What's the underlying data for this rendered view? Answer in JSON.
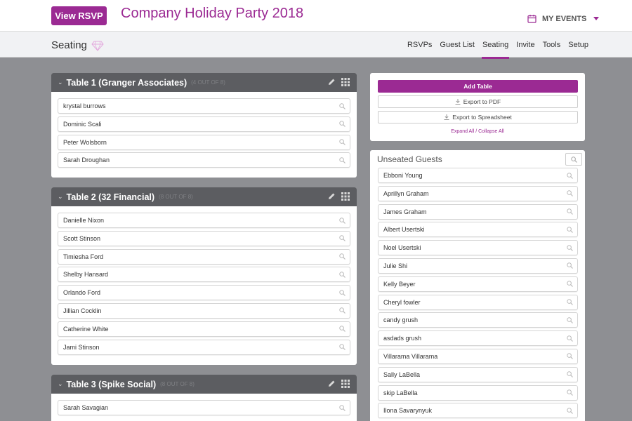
{
  "header": {
    "view_rsvp_label": "View RSVP",
    "event_title": "Company Holiday Party 2018",
    "my_events_label": "MY EVENTS"
  },
  "subnav": {
    "section_title": "Seating",
    "tabs": [
      "RSVPs",
      "Guest List",
      "Seating",
      "Invite",
      "Tools",
      "Setup"
    ],
    "active_tab": "Seating"
  },
  "tables": [
    {
      "name": "Table 1 (Granger Associates)",
      "count": "(4 OUT OF 8)",
      "guests": [
        "krystal burrows",
        "Dominic Scali",
        "Peter Wolsborn",
        "Sarah Droughan"
      ]
    },
    {
      "name": "Table 2 (32 Financial)",
      "count": "(8 OUT OF 8)",
      "guests": [
        "Danielle Nixon",
        "Scott Stinson",
        "Timiesha Ford",
        "Shelby Hansard",
        "Orlando Ford",
        "Jillian Cocklin",
        "Catherine White",
        "Jami Stinson"
      ]
    },
    {
      "name": "Table 3 (Spike Social)",
      "count": "(8 OUT OF 8)",
      "guests": [
        "Sarah Savagian"
      ]
    }
  ],
  "actions": {
    "add_table_label": "Add Table",
    "export_pdf_label": "Export to PDF",
    "export_spreadsheet_label": "Export to Spreadsheet",
    "expand_collapse_label": "Expand All / Collapse All"
  },
  "unseated": {
    "title": "Unseated Guests",
    "guests": [
      "Ebboni Young",
      "Aprillyn Graham",
      "James Graham",
      "Albert Usertski",
      "Noel Usertski",
      "Julie Shi",
      "Kelly Beyer",
      "Cheryl fowler",
      "candy grush",
      "asdads grush",
      "Villarama Villarama",
      "Sally LaBella",
      "skip LaBella",
      "Ilona Savarynyuk"
    ]
  },
  "colors": {
    "accent": "#9b2a93",
    "background": "#8e8f93",
    "table_header": "#5c5d61"
  },
  "icons": [
    "calendar-icon",
    "caret-down-icon",
    "gem-icon",
    "chevron-down-icon",
    "pencil-icon",
    "grid-icon",
    "search-icon",
    "download-icon"
  ]
}
